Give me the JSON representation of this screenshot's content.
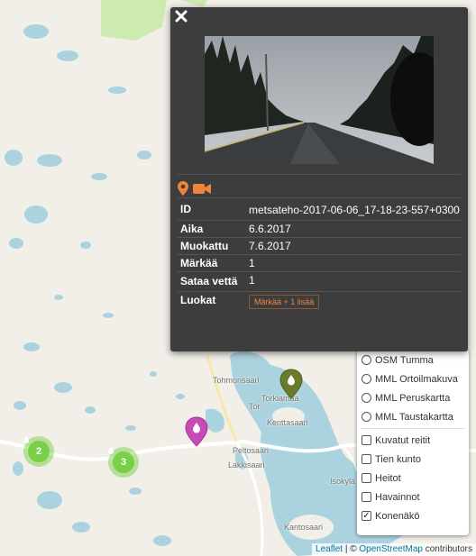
{
  "popup": {
    "close_icon": "close-icon",
    "photo": "road-photo",
    "media_icons": [
      "map-marker-icon",
      "video-camera-icon"
    ],
    "accent_color": "#f0843c",
    "fields": [
      {
        "key": "ID",
        "value": "metsateho-2017-06-06_17-18-23-557+0300"
      },
      {
        "key": "Aika",
        "value": "6.6.2017"
      },
      {
        "key": "Muokattu",
        "value": "7.6.2017"
      },
      {
        "key": "Märkää",
        "value": "1"
      },
      {
        "key": "Sataa vettä",
        "value": "1"
      }
    ],
    "luokat_label": "Luokat",
    "luokat_tag": "Märkää + 1 lisää"
  },
  "map": {
    "places": [
      "Tohmonsaari",
      "Torkiamaa",
      "Kenttasaari",
      "Peltosaari",
      "Lakkisaari",
      "Isokylä",
      "Kantosaari",
      "Tor"
    ],
    "clusters": [
      {
        "count": "2"
      },
      {
        "count": "3"
      }
    ],
    "marker_colors": {
      "pink": "#c84bb5",
      "olive": "#6a7c2b"
    }
  },
  "layers": {
    "base": [
      "OSM Tumma",
      "MML Ortoilmakuva",
      "MML Peruskartta",
      "MML Taustakartta"
    ],
    "overlays": [
      {
        "label": "Kuvatut reitit",
        "checked": false
      },
      {
        "label": "Tien kunto",
        "checked": false
      },
      {
        "label": "Heitot",
        "checked": false
      },
      {
        "label": "Havainnot",
        "checked": false
      },
      {
        "label": "Konenäkö",
        "checked": true
      }
    ]
  },
  "attribution": {
    "leaflet": "Leaflet",
    "sep": " | © ",
    "osm": "OpenStreetMap",
    "contrib": " contributors"
  }
}
